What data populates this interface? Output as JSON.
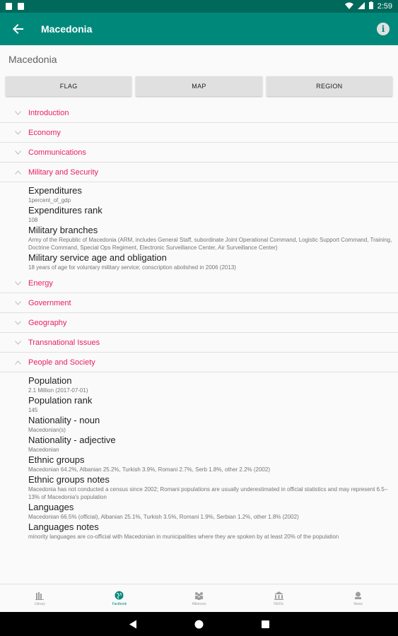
{
  "status_bar": {
    "time": "2:59"
  },
  "app_bar": {
    "title": "Macedonia"
  },
  "country_heading": "Macedonia",
  "buttons": {
    "flag": "FLAG",
    "map": "MAP",
    "region": "REGION"
  },
  "sections": [
    {
      "label": "Introduction",
      "expanded": false
    },
    {
      "label": "Economy",
      "expanded": false
    },
    {
      "label": "Communications",
      "expanded": false
    },
    {
      "label": "Military and Security",
      "expanded": true
    },
    {
      "label": "Energy",
      "expanded": false
    },
    {
      "label": "Government",
      "expanded": false
    },
    {
      "label": "Geography",
      "expanded": false
    },
    {
      "label": "Transnational Issues",
      "expanded": false
    },
    {
      "label": "People and Society",
      "expanded": true
    }
  ],
  "military": [
    {
      "title": "Expenditures",
      "value": "1percent_of_gdp"
    },
    {
      "title": "Expenditures rank",
      "value": "108"
    },
    {
      "title": "Military branches",
      "value": "Army of the Republic of Macedonia (ARM, includes General Staff, subordinate Joint Operational Command, Logistic Support Command, Training, Doctrine Command, Special Ops Regiment, Electronic Surveillance Center, Air Surveillance Center)"
    },
    {
      "title": "Military service age and obligation",
      "value": "18 years of age for voluntary military service; conscription abolished in 2006 (2013)"
    }
  ],
  "people": [
    {
      "title": "Population",
      "value": "2.1 Million (2017-07-01)"
    },
    {
      "title": "Population rank",
      "value": "145"
    },
    {
      "title": "Nationality - noun",
      "value": "Macedonian(s)"
    },
    {
      "title": "Nationality - adjective",
      "value": "Macedonian"
    },
    {
      "title": "Ethnic groups",
      "value": "Macedonian 64.2%, Albanian 25.2%, Turkish 3.9%, Romani 2.7%, Serb 1.8%, other 2.2% (2002)"
    },
    {
      "title": "Ethnic groups notes",
      "value": "Macedonia has not conducted a census since 2002; Romani populations are usually underestimated in official statistics and may represent 6.5–13% of Macedonia's population"
    },
    {
      "title": "Languages",
      "value": "Macedonian 66.5% (official), Albanian 25.1%, Turkish 3.5%, Romani 1.9%, Serbian 1.2%, other 1.8% (2002)"
    },
    {
      "title": "Languages notes",
      "value": "minority languages are co-official with Macedonian in municipalities where they are spoken by at least 20% of the population"
    }
  ],
  "bottom_nav": [
    {
      "label": "Library",
      "icon": "library-icon"
    },
    {
      "label": "Factbook",
      "icon": "globe-icon",
      "active": true
    },
    {
      "label": "Alliances",
      "icon": "people-icon"
    },
    {
      "label": "NGOs",
      "icon": "building-icon"
    },
    {
      "label": "News",
      "icon": "news-icon"
    }
  ],
  "colors": {
    "primary": "#00897b",
    "primary_dark": "#00695c",
    "accent": "#e91e63"
  }
}
